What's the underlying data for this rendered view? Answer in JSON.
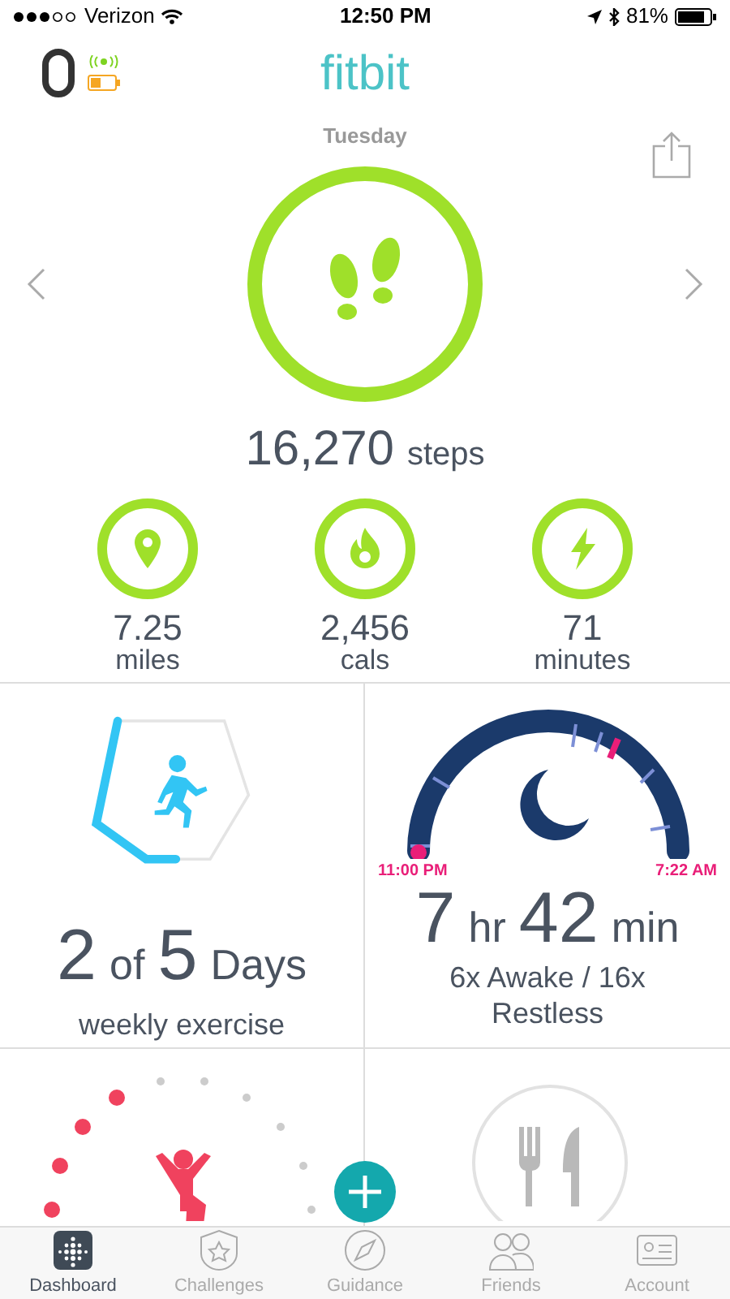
{
  "status_bar": {
    "carrier": "Verizon",
    "time": "12:50 PM",
    "battery": "81%"
  },
  "header": {
    "logo": "fitbit"
  },
  "day": "Tuesday",
  "steps": {
    "value": "16,270",
    "unit": "steps",
    "level": 1
  },
  "stats": [
    {
      "kind": "distance",
      "value": "7.25",
      "unit": "miles",
      "level": 1
    },
    {
      "kind": "calories",
      "value": "2,456",
      "unit": "cals",
      "level": 1
    },
    {
      "kind": "active",
      "value": "71",
      "unit": "minutes",
      "level": 1
    }
  ],
  "exercise": {
    "done": "2",
    "of": "of",
    "goal": "5",
    "unit": "Days",
    "caption": "weekly exercise"
  },
  "sleep": {
    "start": "11:00 PM",
    "end": "7:22 AM",
    "hours": "7",
    "hours_unit": "hr",
    "minutes": "42",
    "minutes_unit": "min",
    "detail": "6x Awake / 16x Restless"
  },
  "tabs": [
    {
      "label": "Dashboard",
      "selected": true
    },
    {
      "label": "Challenges",
      "selected": false
    },
    {
      "label": "Guidance",
      "selected": false
    },
    {
      "label": "Friends",
      "selected": false
    },
    {
      "label": "Account",
      "selected": false
    }
  ]
}
